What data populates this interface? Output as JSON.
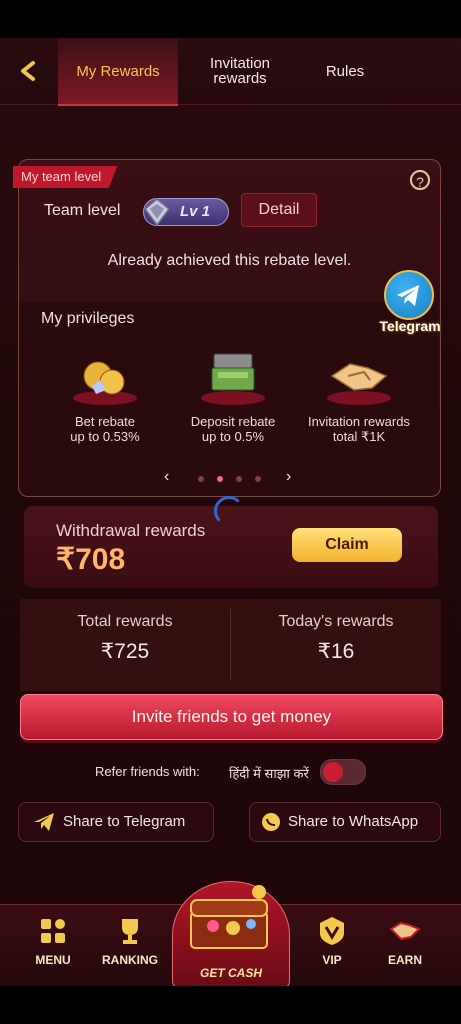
{
  "header": {
    "tabs": [
      "My Rewards",
      "Invitation\nrewards",
      "Rules"
    ],
    "active_tab": 0
  },
  "team_card": {
    "ribbon": "My team level",
    "team_level_label": "Team level",
    "level_badge": "Lv 1",
    "detail_button": "Detail",
    "status_text": "Already achieved this rebate level.",
    "privileges_title": "My privileges",
    "privileges": [
      {
        "line1": "Bet rebate",
        "line2": "up to 0.53%"
      },
      {
        "line1": "Deposit rebate",
        "line2": "up to 0.5%"
      },
      {
        "line1": "Invitation rewards",
        "line2": "total ₹1K"
      }
    ],
    "carousel_dots": 4,
    "carousel_active": 1
  },
  "telegram_badge": "Telegram",
  "withdrawal": {
    "label": "Withdrawal rewards",
    "amount": "₹708",
    "claim_button": "Claim"
  },
  "totals": {
    "total_label": "Total rewards",
    "total_value": "₹725",
    "today_label": "Today's rewards",
    "today_value": "₹16"
  },
  "invite_button": "Invite friends to get money",
  "refer": {
    "label": "Refer friends with:",
    "language": "हिंदी में साझा करें"
  },
  "share": {
    "telegram": "Share to Telegram",
    "whatsapp": "Share to WhatsApp"
  },
  "nav": {
    "menu": "MENU",
    "ranking": "RANKING",
    "get_cash": "GET CASH",
    "vip": "VIP",
    "earn": "EARN"
  },
  "colors": {
    "accent_gold": "#f2c94c",
    "primary_red": "#d7303d",
    "background": "#220709"
  }
}
